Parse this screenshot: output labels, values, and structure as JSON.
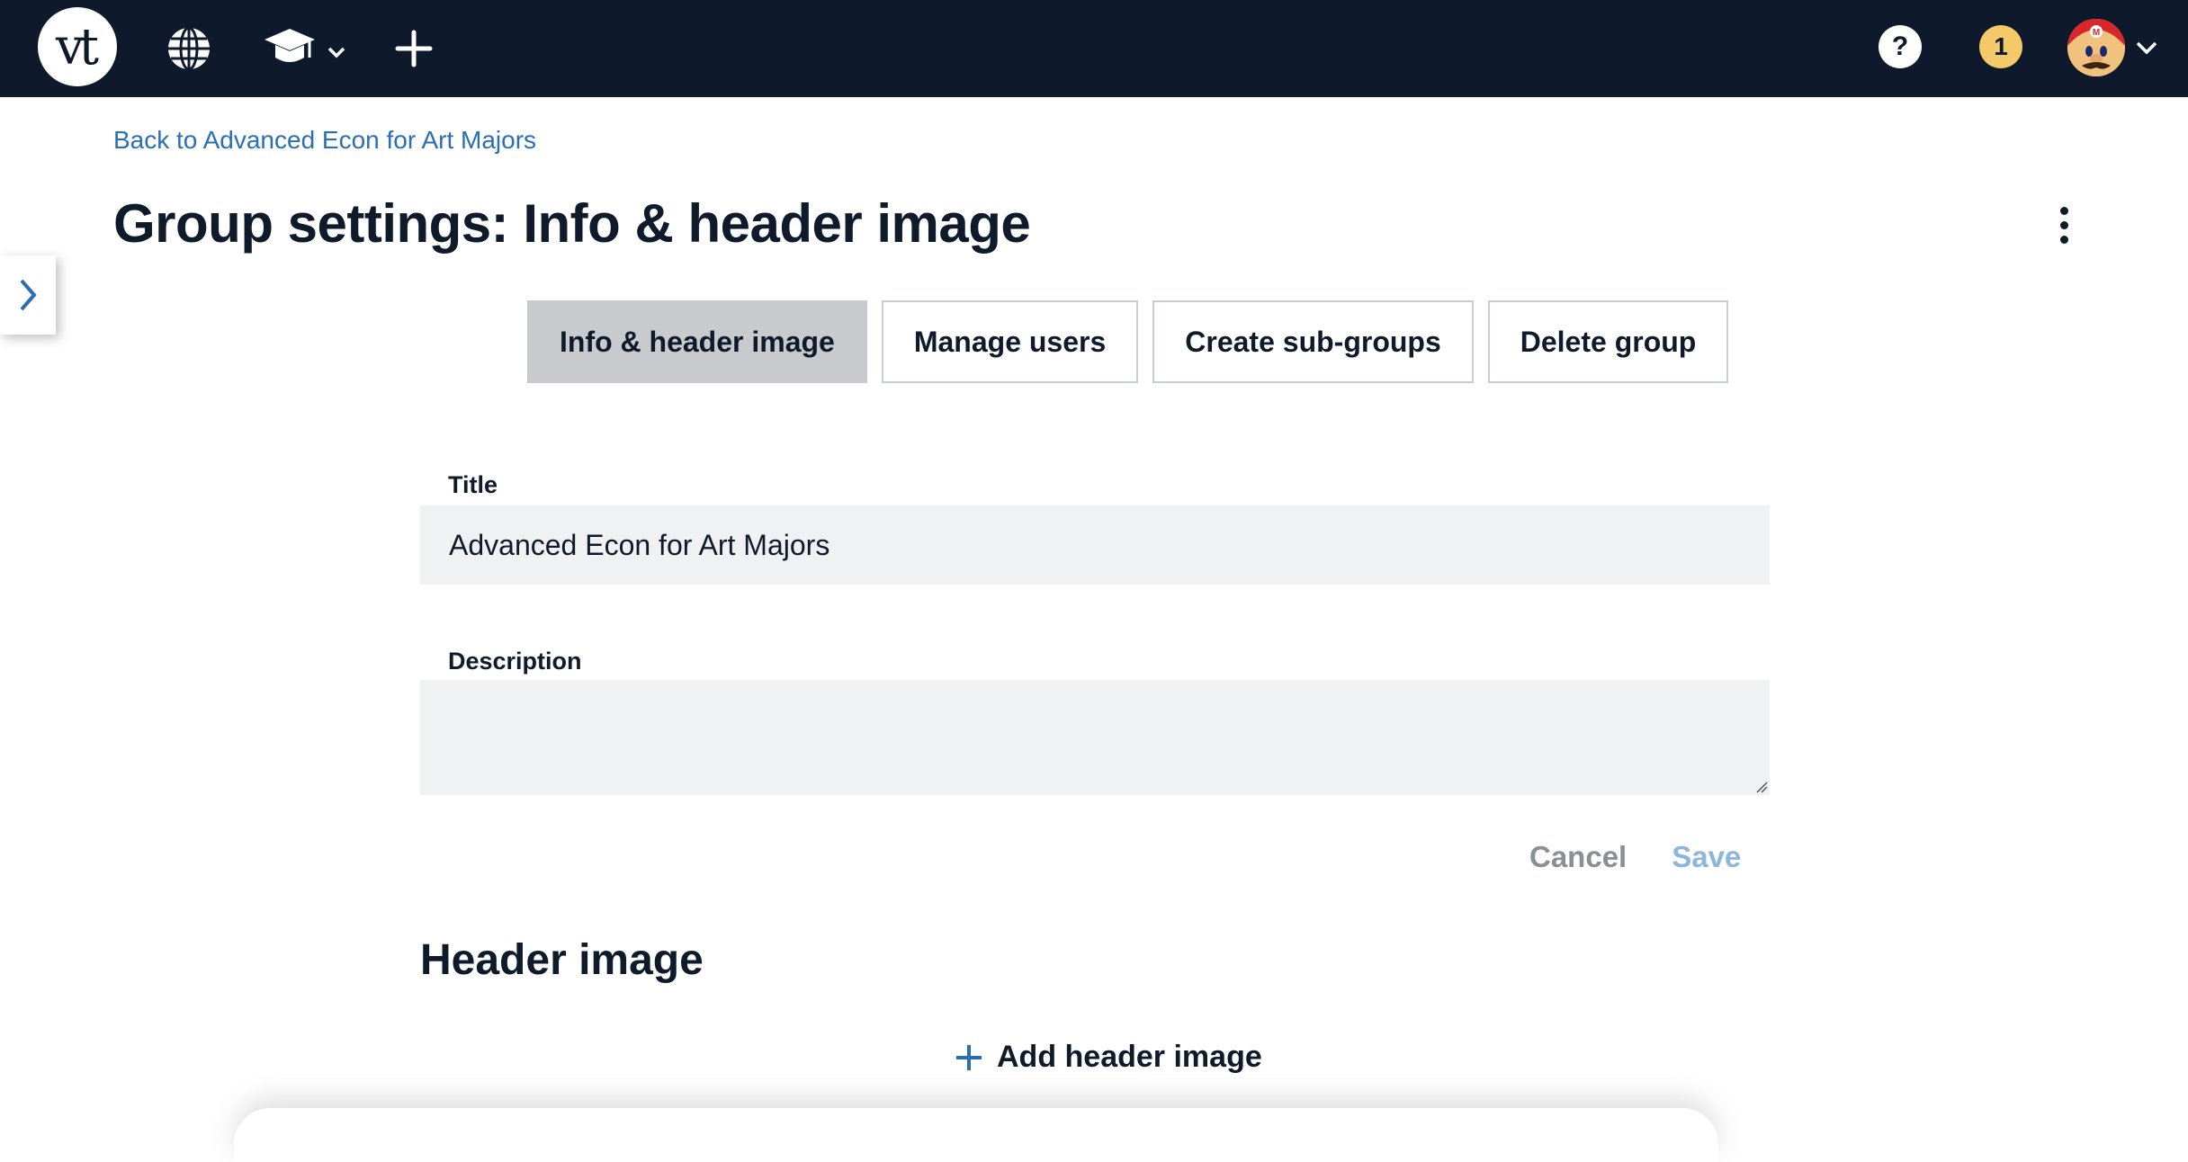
{
  "topbar": {
    "logo_text": "vt",
    "icons": [
      "globe-icon",
      "graduation-cap-icon",
      "plus-icon"
    ],
    "help_label": "?",
    "notification_count": "1",
    "background_color": "#0e1a2b",
    "notification_color": "#f3c969"
  },
  "breadcrumb": {
    "back_label": "Back to Advanced Econ for Art Majors"
  },
  "header": {
    "title": "Group settings: Info & header image"
  },
  "tabs": [
    {
      "label": "Info & header image",
      "active": true
    },
    {
      "label": "Manage users",
      "active": false
    },
    {
      "label": "Create sub-groups",
      "active": false
    },
    {
      "label": "Delete group",
      "active": false
    }
  ],
  "form": {
    "title_label": "Title",
    "title_value": "Advanced Econ for Art Majors",
    "description_label": "Description",
    "description_value": "",
    "cancel_label": "Cancel",
    "save_label": "Save"
  },
  "header_image": {
    "section_title": "Header image",
    "add_label": "Add header image"
  },
  "colors": {
    "link": "#2a6fb3",
    "active_tab": "#c8cacd",
    "input_bg": "#f0f1f3"
  }
}
